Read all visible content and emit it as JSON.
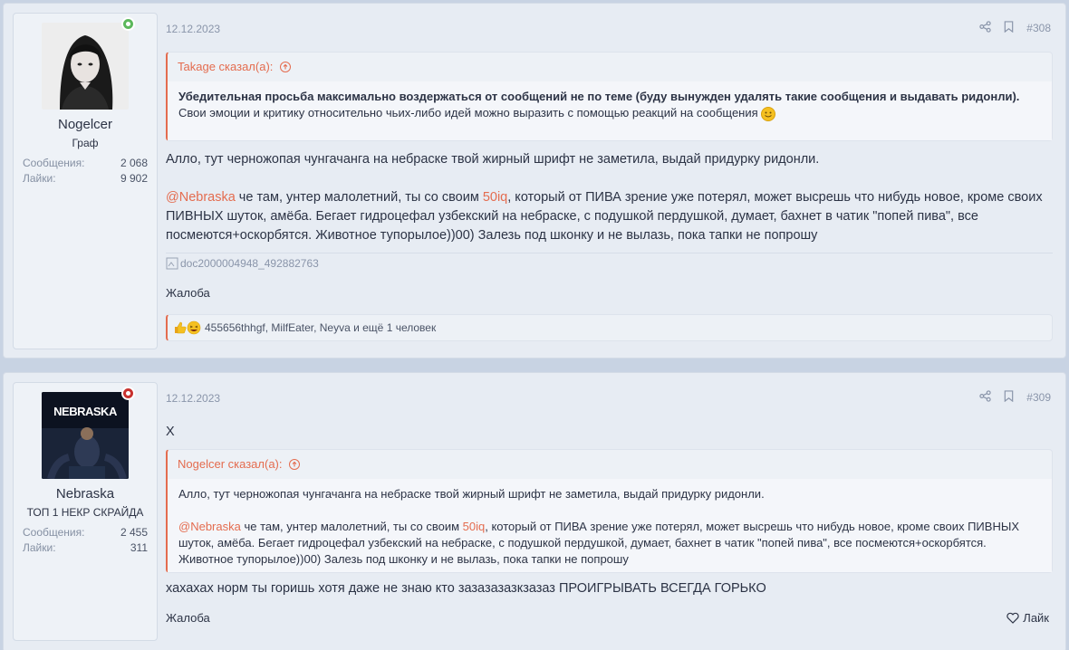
{
  "post1": {
    "user": {
      "name": "Nogelcer",
      "title": "Граф",
      "messages_label": "Сообщения:",
      "messages": "2 068",
      "likes_label": "Лайки:",
      "likes": "9 902",
      "status": "online"
    },
    "date": "12.12.2023",
    "number": "#308",
    "quote": {
      "author": "Takage",
      "said": "сказал(а):",
      "bold": "Убедительная просьба максимально воздержаться от сообщений не по теме (буду вынужден удалять такие сообщения и выдавать ридонли).",
      "normal": "Свои эмоции и критику относительно чьих-либо идей можно выразить с помощью реакций на сообщения"
    },
    "text1": "Алло, тут черножопая чунгачанга на небраске твой жирный шрифт не заметила, выдай придурку ридонли.",
    "mention": "@Nebraska",
    "text2_a": " че там, унтер малолетний, ты со своим ",
    "text2_hl": "50iq",
    "text2_b": ", который от ПИВА зрение уже потерял, может высрешь что нибудь новое, кроме своих ПИВНЫХ шуток, амёба. Бегает гидроцефал узбекский на небраске, с подушкой пердушкой, думает, бахнет в чатик \"попей пива\", все посмеются+оскорбятся. Животное тупорылое))00) Залезь под шконку и не вылазь, пока тапки не попрошу",
    "image_alt": "doc2000004948_492882763",
    "report": "Жалоба",
    "reactions": "455656thhgf, MilfEater, Neyva и ещё 1 человек"
  },
  "post2": {
    "user": {
      "name": "Nebraska",
      "title": "ТОП 1 НЕКР СКРАЙДА",
      "messages_label": "Сообщения:",
      "messages": "2 455",
      "likes_label": "Лайки:",
      "likes": "311",
      "status": "busy",
      "avatar_text": "NEBRASKA"
    },
    "date": "12.12.2023",
    "number": "#309",
    "text_top": "Х",
    "quote": {
      "author": "Nogelcer",
      "said": "сказал(а):",
      "line1": "Алло, тут черножопая чунгачанга на небраске твой жирный шрифт не заметила, выдай придурку ридонли.",
      "mention": "@Nebraska",
      "line2_a": " че там, унтер малолетний, ты со своим ",
      "line2_hl": "50iq",
      "line2_b": ", который от ПИВА зрение уже потерял, может высрешь что нибудь новое, кроме своих ПИВНЫХ шуток, амёба. Бегает гидроцефал узбекский на небраске, с подушкой пердушкой, думает, бахнет в чатик \"попей пива\", все посмеются+оскорбятся. Животное тупорылое))00) Залезь под шконку и не вылазь, пока тапки не попрошу"
    },
    "text": "хахахах норм ты горишь хотя даже не знаю кто зазазазазкзазаз ПРОИГРЫВАТЬ ВСЕГДА ГОРЬКО",
    "report": "Жалоба",
    "like": "Лайк"
  },
  "colors": {
    "accent": "#e46c4f",
    "online": "#5cb85c",
    "busy": "#c8312e"
  }
}
